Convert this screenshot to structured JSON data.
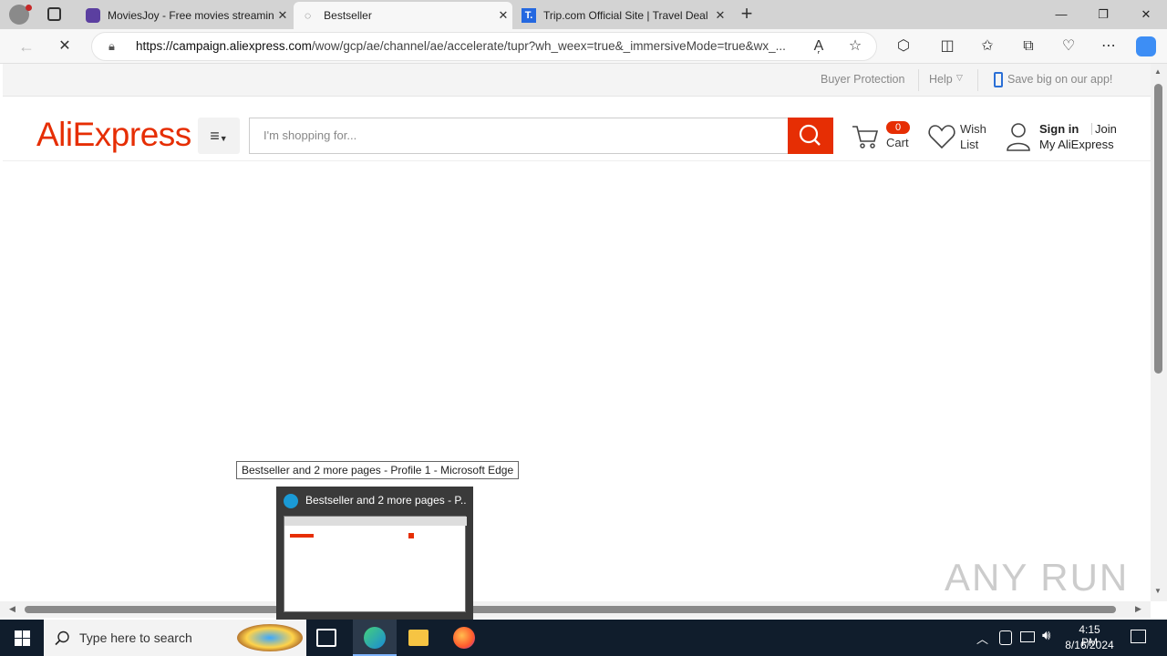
{
  "browser": {
    "tabs": [
      {
        "title": "MoviesJoy - Free movies streamin",
        "active": false
      },
      {
        "title": "Bestseller",
        "active": true
      },
      {
        "title": "Trip.com Official Site | Travel Deal",
        "active": false
      }
    ],
    "new_tab": "+",
    "url": {
      "host": "https://campaign.aliexpress.com",
      "path": "/wow/gcp/ae/channel/ae/accelerate/tupr?wh_weex=true&_immersiveMode=true&wx_..."
    }
  },
  "site": {
    "top_links": {
      "buyer_protection": "Buyer Protection",
      "help": "Help",
      "app": "Save big on our app!"
    },
    "logo": "AliExpress",
    "search_placeholder": "I'm shopping for...",
    "cart": {
      "count": "0",
      "label": "Cart"
    },
    "wishlist": {
      "line1": "Wish",
      "line2": "List"
    },
    "account": {
      "sign_in": "Sign in",
      "join": "Join",
      "my": "My AliExpress"
    }
  },
  "tooltip": "Bestseller and 2 more pages - Profile 1 - Microsoft Edge",
  "thumbnail_title": "Bestseller and 2 more pages - P...",
  "taskbar": {
    "search_placeholder": "Type here to search",
    "time": "4:15 PM",
    "date": "8/16/2024"
  },
  "watermark": "ANY RUN",
  "colors": {
    "brand": "#e62e04",
    "taskbar": "#101d2c"
  }
}
